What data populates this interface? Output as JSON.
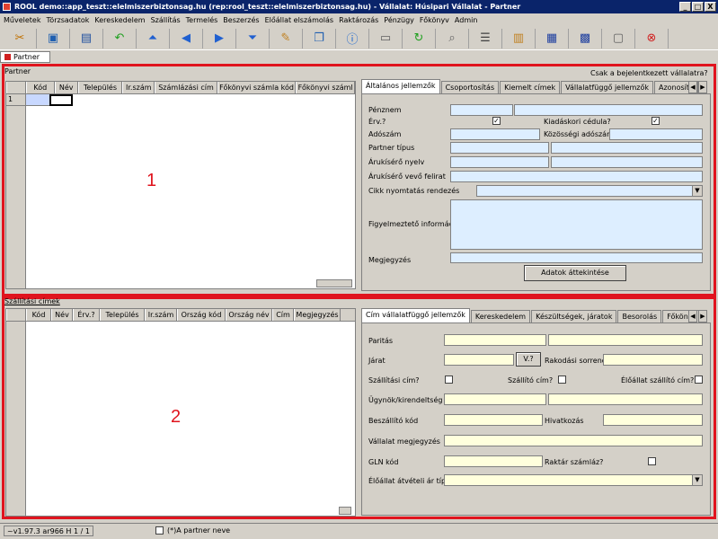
{
  "window": {
    "title": "ROOL demo::app_teszt::elelmiszerbiztonsag.hu (rep:rool_teszt::elelmiszerbiztonsag.hu) - Vállalat: Húsipari Vállalat - Partner",
    "min": "_",
    "max": "□",
    "close": "X"
  },
  "menu": [
    "Műveletek",
    "Törzsadatok",
    "Kereskedelem",
    "Szállítás",
    "Termelés",
    "Beszerzés",
    "Előállat elszámolás",
    "Raktározás",
    "Pénzügy",
    "Főkönyv",
    "Admin"
  ],
  "toolbar_icons": [
    "tools-icon",
    "open-icon",
    "save-icon",
    "undo-icon",
    "first-icon",
    "prev-icon",
    "next-icon",
    "last-icon",
    "edit-icon",
    "copy-icon",
    "info-icon",
    "window-icon",
    "refresh-icon",
    "search-icon",
    "list-icon",
    "filter-icon",
    "grid-icon",
    "table-icon",
    "calendar-icon",
    "exit-icon"
  ],
  "doc_tab": "Partner",
  "partner": {
    "label": "Partner",
    "columns": [
      "Kód",
      "Név",
      "Település",
      "Ir.szám",
      "Számlázási cím",
      "Főkönyvi számla kód",
      "Főkönyvi száml"
    ],
    "row_num": "1",
    "only_current_company": "Csak a bejelentkezett vállalatra?",
    "tabs": [
      "Általános jellemzők",
      "Csoportosítás",
      "Kiemelt címek",
      "Vállalatfüggő jellemzők",
      "Azonosító"
    ],
    "fields": {
      "penznem": "Pénznem",
      "erv": "Érv.?",
      "kiadaskori": "Kiadáskori cédula?",
      "adoszam": "Adószám",
      "kozossegi": "Közösségi adószám",
      "partner_tipus": "Partner típus",
      "arukiserő_nyelv": "Árukísérő nyelv",
      "arukisero_vevo": "Árukísérő vevő felirat",
      "cikk_rendezes": "Cikk nyomtatás rendezés",
      "figyelmezteto": "Figyelmeztető információ",
      "megjegyzes": "Megjegyzés",
      "adatok_button": "Adatok áttekintése"
    }
  },
  "shipping": {
    "label": "Szállítási címek",
    "columns": [
      "Kód",
      "Név",
      "Érv.?",
      "Település",
      "Ir.szám",
      "Ország kód",
      "Ország név",
      "Cím",
      "Megjegyzés"
    ],
    "tabs": [
      "Cím vállalatfüggő jellemzők",
      "Kereskedelem",
      "Készültségek, járatok",
      "Besorolás",
      "Főkönyv"
    ],
    "fields": {
      "paritas": "Paritás",
      "jarat": "Járat",
      "v_button": "V.?",
      "rakodasi": "Rakodási sorrend",
      "szallitasi_cim": "Szállítási cím?",
      "szallito_cim": "Szállító cím?",
      "eloallat_szallito": "Élőállat szállító cím?",
      "ugynok": "Ügynök/kirendeltség",
      "beszallito": "Beszállító kód",
      "hivatkozas": "Hivatkozás",
      "vallalat_megj": "Vállalat megjegyzés",
      "gln": "GLN kód",
      "raktar_szamlaz": "Raktár számláz?",
      "eloallat_atveteli": "Élőállat átvételi ár típus"
    }
  },
  "annotations": {
    "one": "1",
    "two": "2"
  },
  "status": {
    "version": "~v1.97.3 ar966 H",
    "records": "1 / 1",
    "hint": "(*)A partner neve"
  },
  "colors": {
    "highlight_red": "#e0141e",
    "title_blue": "#0a246a",
    "field_blue": "#ddeeff",
    "field_yellow": "#ffffdd"
  }
}
